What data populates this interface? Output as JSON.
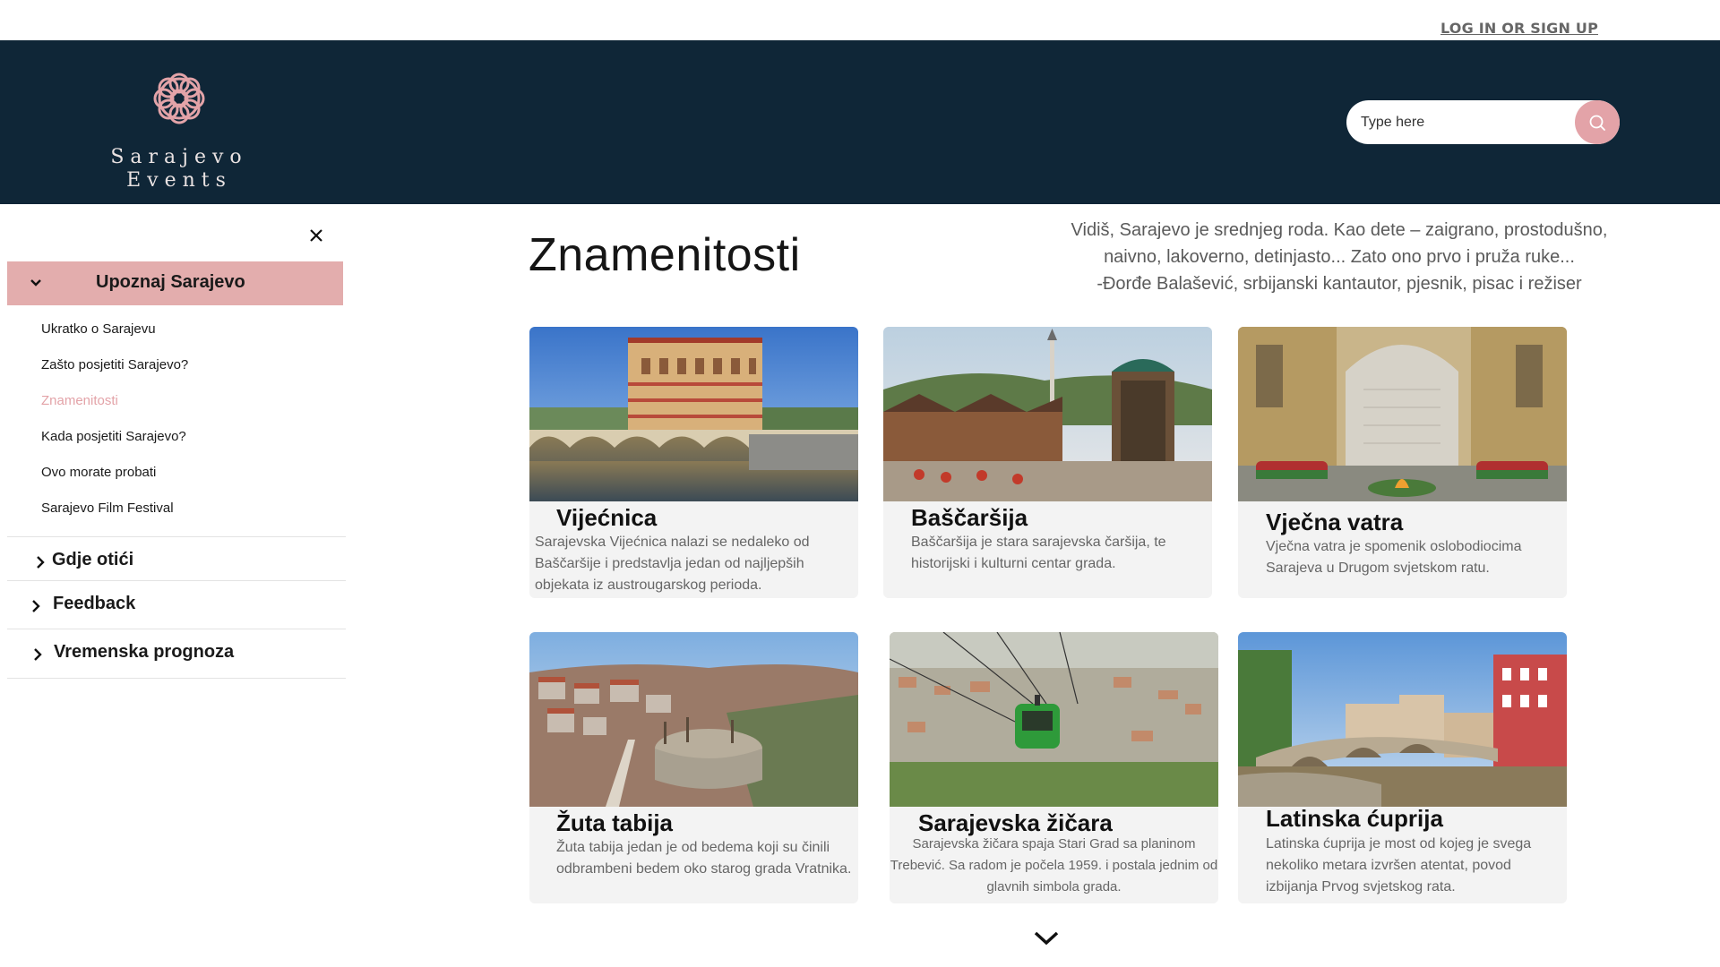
{
  "topbar": {
    "login_label": "LOG IN OR SIGN UP"
  },
  "header": {
    "logo_line1": "Sarajevo",
    "logo_line2": "Events",
    "search_placeholder": "Type here",
    "colors": {
      "header_bg": "#0f2637",
      "accent": "#e3a3a8"
    }
  },
  "sidebar": {
    "active_section": "Upoznaj Sarajevo",
    "submenu": [
      "Ukratko o Sarajevu",
      "Zašto posjetiti Sarajevo?",
      "Znamenitosti",
      "Kada posjetiti Sarajevo?",
      "Ovo morate probati",
      "Sarajevo Film Festival"
    ],
    "active_submenu_index": 2,
    "sections": [
      "Gdje otići",
      "Feedback",
      "Vremenska prognoza"
    ]
  },
  "main": {
    "title": "Znamenitosti",
    "quote_line1": "Vidiš, Sarajevo je srednjeg roda. Kao dete – zaigrano, prostodušno,",
    "quote_line2": "naivno, lakoverno, detinjasto... Zato ono prvo i pruža ruke...",
    "quote_line3": "-Đorđe Balašević, srbijanski kantautor, pjesnik, pisac i režiser",
    "cards": [
      {
        "title": "Vijećnica",
        "desc": "Sarajevska Vijećnica nalazi se nedaleko od Baščaršije i predstavlja jedan od najljepših objekata iz austrougarskog perioda.",
        "icon": "city-hall-photo"
      },
      {
        "title": "Baščaršija",
        "desc": "Baščaršija je stara sarajevska čaršija, te historijski i kulturni centar grada.",
        "icon": "old-bazaar-photo"
      },
      {
        "title": "Vječna vatra",
        "desc": "Vječna vatra je spomenik oslobodiocima Sarajeva u Drugom svjetskom ratu.",
        "icon": "eternal-flame-photo"
      },
      {
        "title": "Žuta tabija",
        "desc": "Žuta tabija jedan je od bedema koji su činili odbrambeni bedem oko starog grada Vratnika.",
        "icon": "fortress-photo"
      },
      {
        "title": "Sarajevska žičara",
        "desc": "Sarajevska žičara spaja Stari Grad sa planinom Trebević. Sa radom je počela 1959. i postala jednim od glavnih simbola grada.",
        "icon": "cable-car-photo"
      },
      {
        "title": "Latinska ćuprija",
        "desc": "Latinska ćuprija je most od kojeg je svega nekoliko metara izvršen atentat, povod izbijanja Prvog svjetskog rata.",
        "icon": "latin-bridge-photo"
      }
    ]
  }
}
